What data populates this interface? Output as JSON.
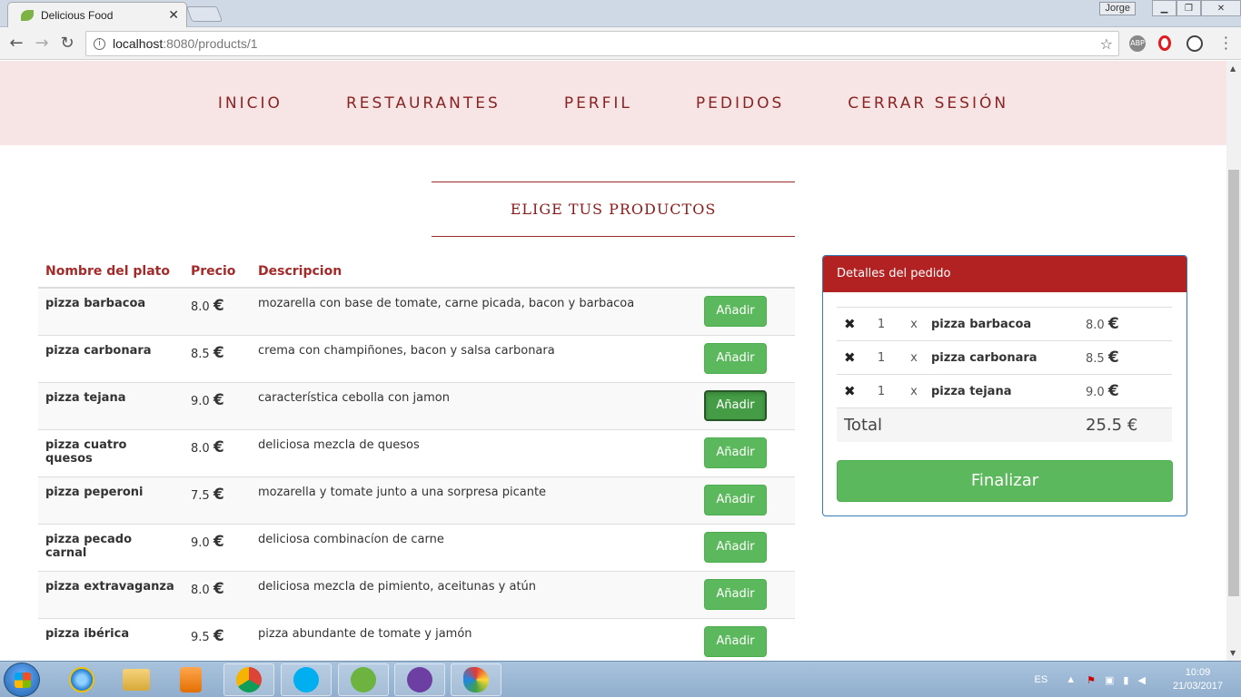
{
  "browser": {
    "tab_title": "Delicious Food",
    "tab_close": "✕",
    "user_name": "Jorge",
    "url_host": "localhost",
    "url_rest": ":8080/products/1"
  },
  "nav": {
    "items": [
      "INICIO",
      "RESTAURANTES",
      "PERFIL",
      "PEDIDOS",
      "CERRAR SESIÓN"
    ]
  },
  "page_heading": "ELIGE TUS PRODUCTOS",
  "products": {
    "headers": {
      "name": "Nombre del plato",
      "price": "Precio",
      "description": "Descripcion"
    },
    "currency": "€",
    "add_label": "Añadir",
    "rows": [
      {
        "name": "pizza barbacoa",
        "price": "8.0",
        "description": "mozarella con base de tomate, carne picada, bacon y barbacoa"
      },
      {
        "name": "pizza carbonara",
        "price": "8.5",
        "description": "crema con champiñones, bacon y salsa carbonara"
      },
      {
        "name": "pizza tejana",
        "price": "9.0",
        "description": "característica cebolla con jamon"
      },
      {
        "name": "pizza cuatro quesos",
        "price": "8.0",
        "description": "deliciosa mezcla de quesos"
      },
      {
        "name": "pizza peperoni",
        "price": "7.5",
        "description": "mozarella y tomate junto a una sorpresa picante"
      },
      {
        "name": "pizza pecado carnal",
        "price": "9.0",
        "description": "deliciosa combinacíon de carne"
      },
      {
        "name": "pizza extravaganza",
        "price": "8.0",
        "description": "deliciosa mezcla de pimiento, aceitunas y atún"
      },
      {
        "name": "pizza ibérica",
        "price": "9.5",
        "description": "pizza abundante de tomate y jamón"
      }
    ]
  },
  "order": {
    "title": "Detalles del pedido",
    "remove_icon": "✖",
    "times": "x",
    "items": [
      {
        "qty": "1",
        "name": "pizza barbacoa",
        "price": "8.0"
      },
      {
        "qty": "1",
        "name": "pizza carbonara",
        "price": "8.5"
      },
      {
        "qty": "1",
        "name": "pizza tejana",
        "price": "9.0"
      }
    ],
    "total_label": "Total",
    "total_value": "25.5",
    "finalize_label": "Finalizar"
  },
  "taskbar": {
    "language": "ES",
    "time": "10:09",
    "date": "21/03/2017"
  }
}
